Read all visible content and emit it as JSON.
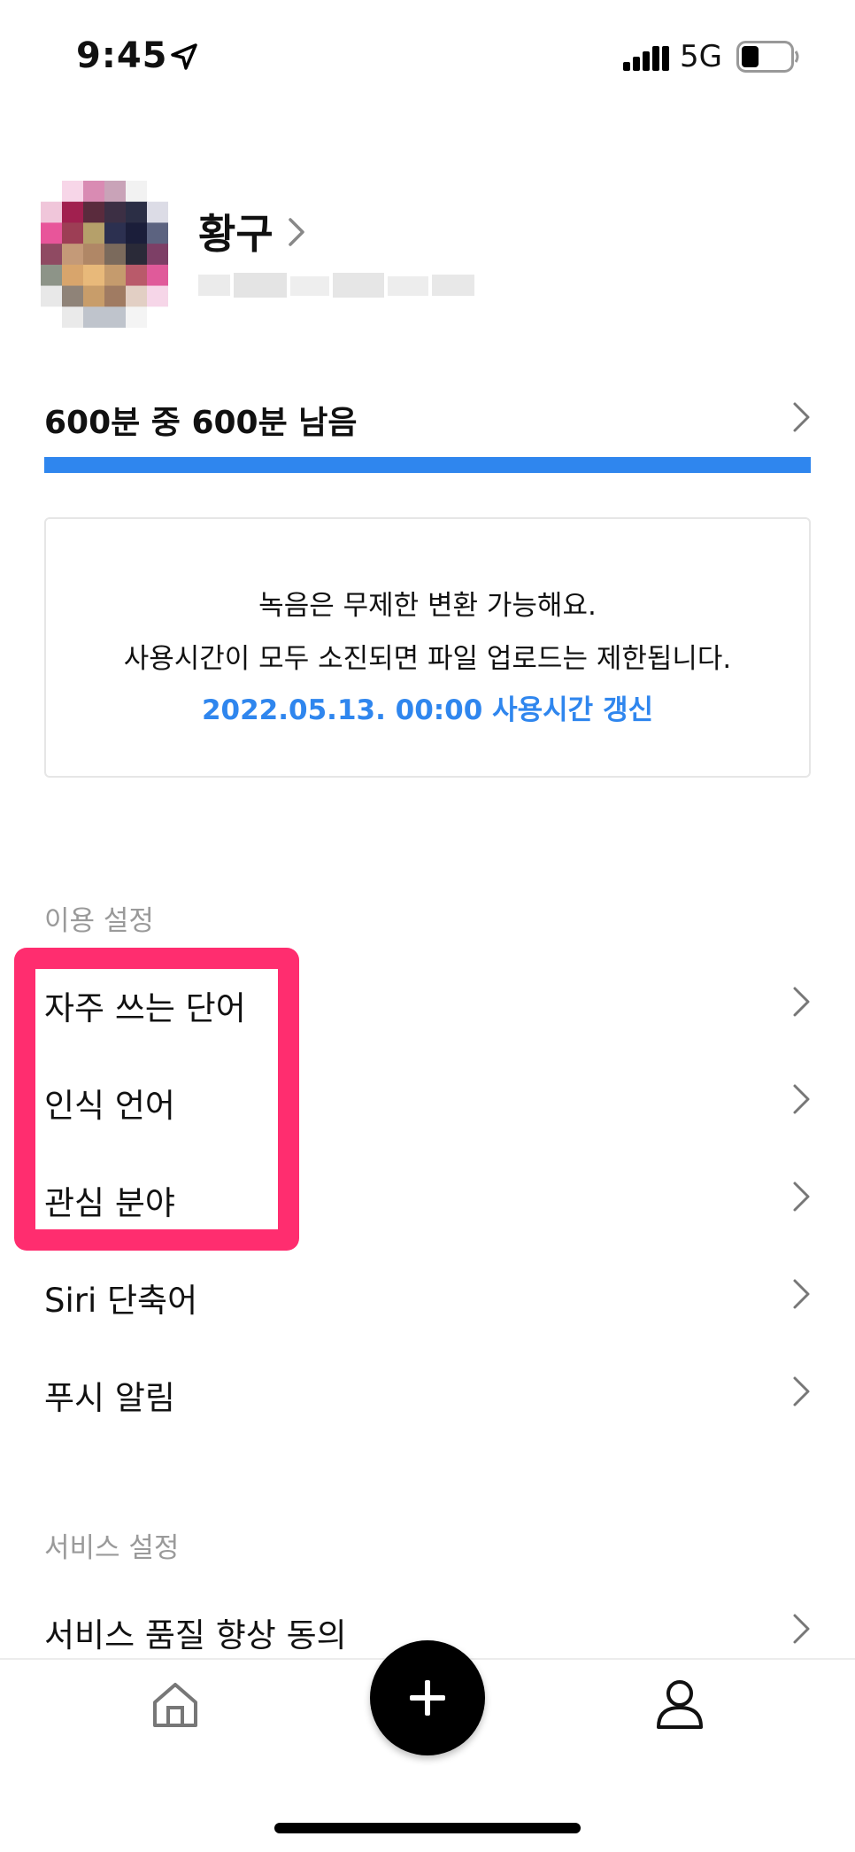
{
  "status_bar": {
    "time": "9:45",
    "network": "5G",
    "battery_level": 0.35
  },
  "profile": {
    "name": "황구",
    "email": ""
  },
  "usage": {
    "text": "600분 중 600분 남음",
    "remaining_fraction": 1.0
  },
  "notice": {
    "line1": "녹음은 무제한 변환 가능해요.",
    "line2": "사용시간이 모두 소진되면 파일 업로드는 제한됩니다.",
    "line3": "2022.05.13. 00:00 사용시간 갱신"
  },
  "usage_settings": {
    "header": "이용 설정",
    "items": [
      {
        "label": "자주 쓰는 단어"
      },
      {
        "label": "인식 언어"
      },
      {
        "label": "관심 분야"
      },
      {
        "label": "Siri 단축어"
      },
      {
        "label": "푸시 알림"
      }
    ]
  },
  "service_settings": {
    "header": "서비스 설정",
    "items": [
      {
        "label": "서비스 품질 향상 동의"
      }
    ]
  },
  "tab_bar": {
    "icons": [
      "home-icon",
      "plus-icon",
      "person-icon"
    ]
  },
  "colors": {
    "accent": "#2f86ee",
    "highlight": "#ff2d6f"
  }
}
